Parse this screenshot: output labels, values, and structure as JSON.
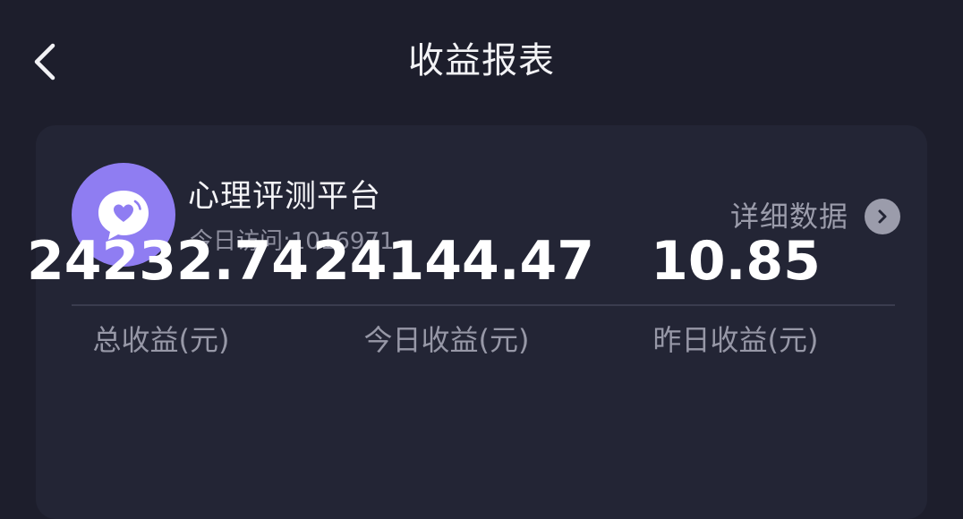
{
  "header": {
    "title": "收益报表",
    "back_icon": "chevron-left-icon"
  },
  "platform": {
    "name": "心理评测平台",
    "visits_text": "今日访问:1016971",
    "avatar_icon": "chat-heart-icon",
    "avatar_color": "#8f7df2"
  },
  "details": {
    "label": "详细数据",
    "icon": "chevron-right-circle-icon"
  },
  "stats": [
    {
      "value": "24232.74",
      "label": "总收益(元)"
    },
    {
      "value": "24144.47",
      "label": "今日收益(元)"
    },
    {
      "value": "10.85",
      "label": "昨日收益(元)"
    }
  ],
  "colors": {
    "background": "#1d1e2c",
    "card": "#232535",
    "accent": "#8f7df2",
    "muted_text": "#9798a7"
  }
}
